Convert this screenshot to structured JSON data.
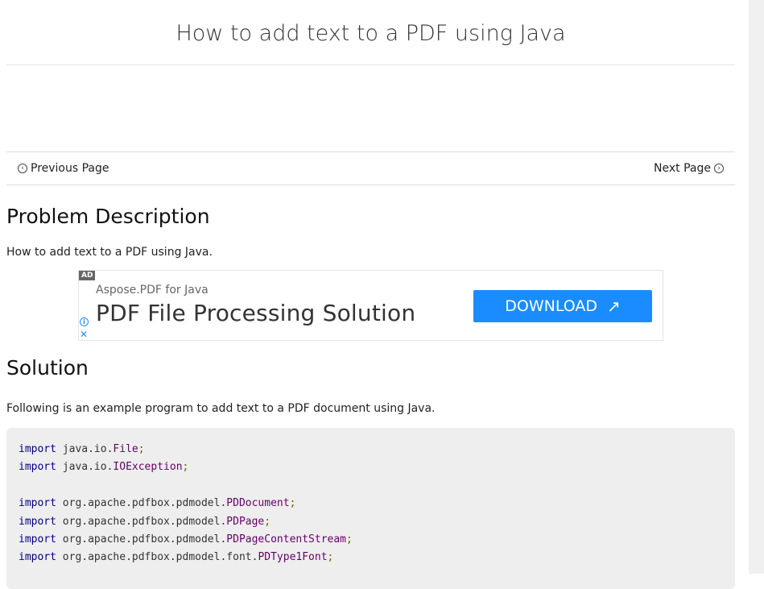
{
  "page": {
    "title": "How to add text to a PDF using Java"
  },
  "pager": {
    "prev_label": "Previous Page",
    "next_label": "Next Page"
  },
  "problem": {
    "heading": "Problem Description",
    "text": "How to add text to a PDF using Java."
  },
  "ad": {
    "tag": "AD",
    "subtitle": "Aspose.PDF for Java",
    "headline": "PDF File Processing Solution",
    "button_label": "DOWNLOAD",
    "button_color": "#1a8cff"
  },
  "solution": {
    "heading": "Solution",
    "text": "Following is an example program to add text to a PDF document using Java."
  },
  "code": {
    "lines": [
      {
        "kw": "import",
        "pkg": "java.io.",
        "cls": "File",
        "end": ";"
      },
      {
        "kw": "import",
        "pkg": "java.io.",
        "cls": "IOException",
        "end": ";"
      },
      {
        "blank": true
      },
      {
        "kw": "import",
        "pkg": "org.apache.pdfbox.pdmodel.",
        "cls": "PDDocument",
        "end": ";"
      },
      {
        "kw": "import",
        "pkg": "org.apache.pdfbox.pdmodel.",
        "cls": "PDPage",
        "end": ";"
      },
      {
        "kw": "import",
        "pkg": "org.apache.pdfbox.pdmodel.",
        "cls": "PDPageContentStream",
        "end": ";"
      },
      {
        "kw": "import",
        "pkg": "org.apache.pdfbox.pdmodel.font.",
        "cls": "PDType1Font",
        "end": ";"
      }
    ]
  }
}
